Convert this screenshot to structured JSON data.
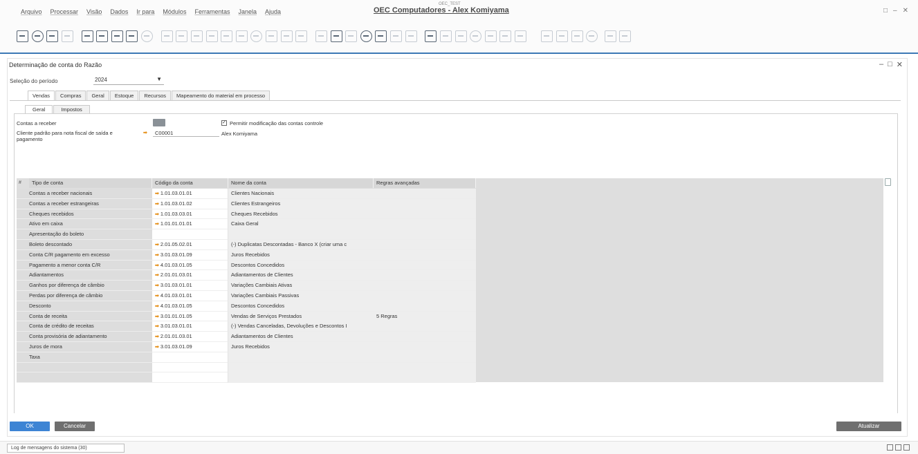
{
  "menu": {
    "items": [
      "Arquivo",
      "Processar",
      "Visão",
      "Dados",
      "Ir para",
      "Módulos",
      "Ferramentas",
      "Janela",
      "Ajuda"
    ],
    "app_title": "OEC Computadores - Alex Komiyama",
    "app_title_sup": "OEC_TEST",
    "window_controls": [
      "□",
      "–",
      "✕"
    ]
  },
  "toolbar": {
    "icons": [
      "form-icon",
      "print-icon",
      "preview-icon",
      "email-icon",
      "web-icon",
      "excel-icon",
      "word-icon",
      "pdf-icon",
      "move-icon",
      "calendar-icon",
      "find-icon",
      "add-icon",
      "first-icon",
      "prev-icon",
      "next-icon",
      "last-icon",
      "refresh-icon",
      "filter-icon",
      "sort-icon",
      "base-doc-icon",
      "target-doc-icon",
      "journal-icon",
      "gross-profit-icon",
      "tree-icon",
      "copy-icon",
      "paste-icon",
      "layout-icon",
      "query-icon",
      "report-icon",
      "msg-icon",
      "calc-icon",
      "dashboard-icon",
      "user-icon",
      "users-icon",
      "settings-icon",
      "addon-icon",
      "image-icon",
      "edit-icon",
      "help-icon"
    ]
  },
  "document": {
    "title": "Determinação de conta do Razão",
    "controls": [
      "–",
      "□",
      "✕"
    ],
    "period_label": "Seleção do período",
    "period_value": "2024",
    "tabs": [
      "Vendas",
      "Compras",
      "Geral",
      "Estoque",
      "Recursos",
      "Mapeamento do material em processo"
    ],
    "active_tab": 0,
    "subtabs": [
      "Geral",
      "Impostos"
    ],
    "active_subtab": 0,
    "fields": {
      "control_accounts_label": "Contas a receber",
      "allow_change_label": "Permitir modificação das contas controle",
      "default_customer_label": "Cliente padrão para nota fiscal de saída e pagamento",
      "default_customer_code": "C00001",
      "default_customer_name": "Alex Komiyama"
    },
    "grid": {
      "hash": "#",
      "headers": [
        "Tipo de conta",
        "Código da conta",
        "Nome da conta",
        "Regras avançadas"
      ],
      "rows": [
        {
          "type": "Contas a receber nacionais",
          "code": "1.01.03.01.01",
          "name": "Clientes Nacionais",
          "rule": ""
        },
        {
          "type": "Contas a receber estrangeiras",
          "code": "1.01.03.01.02",
          "name": "Clientes Estrangeiros",
          "rule": ""
        },
        {
          "type": "Cheques recebidos",
          "code": "1.01.03.03.01",
          "name": "Cheques Recebidos",
          "rule": ""
        },
        {
          "type": "Ativo em caixa",
          "code": "1.01.01.01.01",
          "name": "Caixa Geral",
          "rule": ""
        },
        {
          "type": "Apresentação do boleto",
          "code": "",
          "name": "",
          "rule": ""
        },
        {
          "type": "Boleto descontado",
          "code": "2.01.05.02.01",
          "name": "(-) Duplicatas Descontadas - Banco X (criar uma c",
          "rule": ""
        },
        {
          "type": "Conta C/R pagamento em excesso",
          "code": "3.01.03.01.09",
          "name": "Juros Recebidos",
          "rule": ""
        },
        {
          "type": "Pagamento a menor conta C/R",
          "code": "4.01.03.01.05",
          "name": "Descontos Concedidos",
          "rule": ""
        },
        {
          "type": "Adiantamentos",
          "code": "2.01.01.03.01",
          "name": "Adiantamentos de Clientes",
          "rule": ""
        },
        {
          "type": "Ganhos por diferença de câmbio",
          "code": "3.01.03.01.01",
          "name": "Variações Cambiais Ativas",
          "rule": ""
        },
        {
          "type": "Perdas por diferença de câmbio",
          "code": "4.01.03.01.01",
          "name": "Variações Cambiais Passivas",
          "rule": ""
        },
        {
          "type": "Desconto",
          "code": "4.01.03.01.05",
          "name": "Descontos Concedidos",
          "rule": ""
        },
        {
          "type": "Conta de receita",
          "code": "3.01.01.01.05",
          "name": "Vendas de Serviços Prestados",
          "rule": "5 Regras"
        },
        {
          "type": "Conta de crédito de receitas",
          "code": "3.01.03.01.01",
          "name": "(-) Vendas Canceladas, Devoluções e Descontos I",
          "rule": ""
        },
        {
          "type": "Conta provisória de adiantamento",
          "code": "2.01.01.03.01",
          "name": "Adiantamentos de Clientes",
          "rule": ""
        },
        {
          "type": "Juros de mora",
          "code": "3.01.03.01.09",
          "name": "Juros Recebidos",
          "rule": ""
        },
        {
          "type": "Taxa",
          "code": "",
          "name": "",
          "rule": ""
        },
        {
          "type": "",
          "code": "",
          "name": "",
          "rule": ""
        },
        {
          "type": "",
          "code": "",
          "name": "",
          "rule": ""
        }
      ]
    },
    "buttons": {
      "ok": "OK",
      "cancel": "Cancelar",
      "update": "Atualizar"
    }
  },
  "statusbar": {
    "tab_label": "Log de mensagens do sistema (30)"
  },
  "colors": {
    "accent": "#3d84d4",
    "toolbar_line": "#3c79b5",
    "link_arrow": "#e58f18",
    "gray_button": "#6f6f6f"
  }
}
